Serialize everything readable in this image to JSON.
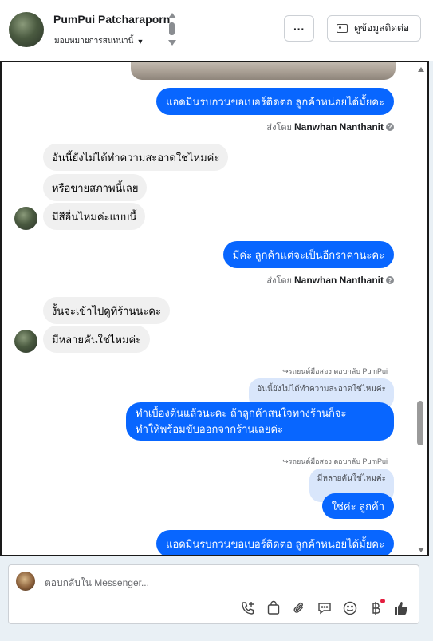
{
  "header": {
    "user_name": "PumPui Patcharaporn",
    "assign_label": "มอบหมายการสนทนานี้",
    "more_label": "···",
    "contact_button_label": "ดูข้อมูลติดต่อ"
  },
  "messages": [
    {
      "id": "m1",
      "direction": "out",
      "text": "แอดมินรบกวนขอเบอร์ติดต่อ ลูกค้าหน่อยได้มั้ยคะ"
    },
    {
      "id": "m1s",
      "sent_by_prefix": "ส่งโดย",
      "sent_by_name": "Nanwhan Nanthanit"
    },
    {
      "id": "m2",
      "direction": "in",
      "text": "อันนี้ยังไม่ได้ทำความสะอาดใช่ไหมค่ะ"
    },
    {
      "id": "m3",
      "direction": "in",
      "text": "หรือขายสภาพนี้เลย"
    },
    {
      "id": "m4",
      "direction": "in",
      "text": "มีสีอื่นไหมค่ะแบบนี้"
    },
    {
      "id": "m5",
      "direction": "out",
      "text": "มีค่ะ  ลูกค้าแต่จะเป็นอีกราคานะคะ"
    },
    {
      "id": "m5s",
      "sent_by_prefix": "ส่งโดย",
      "sent_by_name": "Nanwhan Nanthanit"
    },
    {
      "id": "m6",
      "direction": "in",
      "text": "งั้นจะเข้าไปดูที่ร้านนะคะ"
    },
    {
      "id": "m7",
      "direction": "in",
      "text": "มีหลายคันใช่ไหมค่ะ"
    },
    {
      "id": "r1",
      "reply_meta": "รถยนต์มือสอง ตอบกลับ PumPui",
      "quote": "อันนี้ยังไม่ได้ทำความสะอาดใช่ไหมค่ะ",
      "line1": "ทำเบื้องต้นแล้วนะคะ  ถ้าลูกค้าสนใจทางร้านก็จะ",
      "line2": "ทำให้พร้อมขับออกจากร้านเลยค่ะ"
    },
    {
      "id": "r2",
      "reply_meta": "รถยนต์มือสอง ตอบกลับ PumPui",
      "quote": "มีหลายคันใช่ไหมค่ะ",
      "text": "ใช่ค่ะ  ลูกค้า"
    },
    {
      "id": "m8",
      "direction": "out",
      "text": "แอดมินรบกวนขอเบอร์ติดต่อ ลูกค้าหน่อยได้มั้ยคะ"
    }
  ],
  "composer": {
    "placeholder": "ตอบกลับใน Messenger...",
    "tools": [
      "phone-add-icon",
      "shopping-bag-icon",
      "paperclip-icon",
      "chat-bubble-icon",
      "smiley-icon",
      "baht-icon",
      "thumbs-up-icon"
    ]
  },
  "colors": {
    "accent": "#0866ff",
    "incoming_bubble": "#f0f0f0",
    "quote_bubble": "#d9e6fb",
    "page_bg": "#e9f0f5"
  }
}
